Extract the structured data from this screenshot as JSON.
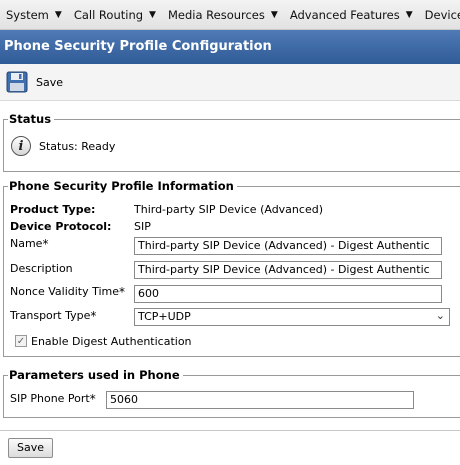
{
  "menu": {
    "items": [
      {
        "label": "System"
      },
      {
        "label": "Call Routing"
      },
      {
        "label": "Media Resources"
      },
      {
        "label": "Advanced Features"
      },
      {
        "label": "Device"
      }
    ]
  },
  "page": {
    "title": "Phone Security Profile Configuration"
  },
  "toolbar": {
    "save_label": "Save",
    "save_icon": "floppy-disk-icon"
  },
  "status": {
    "legend": "Status",
    "icon": "info-icon",
    "text": "Status: Ready"
  },
  "info": {
    "legend": "Phone Security Profile Information",
    "product_type_label": "Product Type:",
    "product_type_value": "Third-party SIP Device (Advanced)",
    "device_protocol_label": "Device Protocol:",
    "device_protocol_value": "SIP",
    "name_label": "Name",
    "name_value": "Third-party SIP Device (Advanced) - Digest Authentic",
    "description_label": "Description",
    "description_value": "Third-party SIP Device (Advanced) - Digest Authentic",
    "nonce_label": "Nonce Validity Time",
    "nonce_value": "600",
    "transport_label": "Transport Type",
    "transport_value": "TCP+UDP",
    "digest_label": "Enable Digest Authentication",
    "digest_checked": true,
    "required_mark": "*"
  },
  "params": {
    "legend": "Parameters used in Phone",
    "sip_port_label": "SIP Phone Port",
    "sip_port_value": "5060"
  },
  "footer": {
    "save_label": "Save"
  },
  "colors": {
    "title_bar": "#3a65a3",
    "title_text": "#ffffff"
  }
}
